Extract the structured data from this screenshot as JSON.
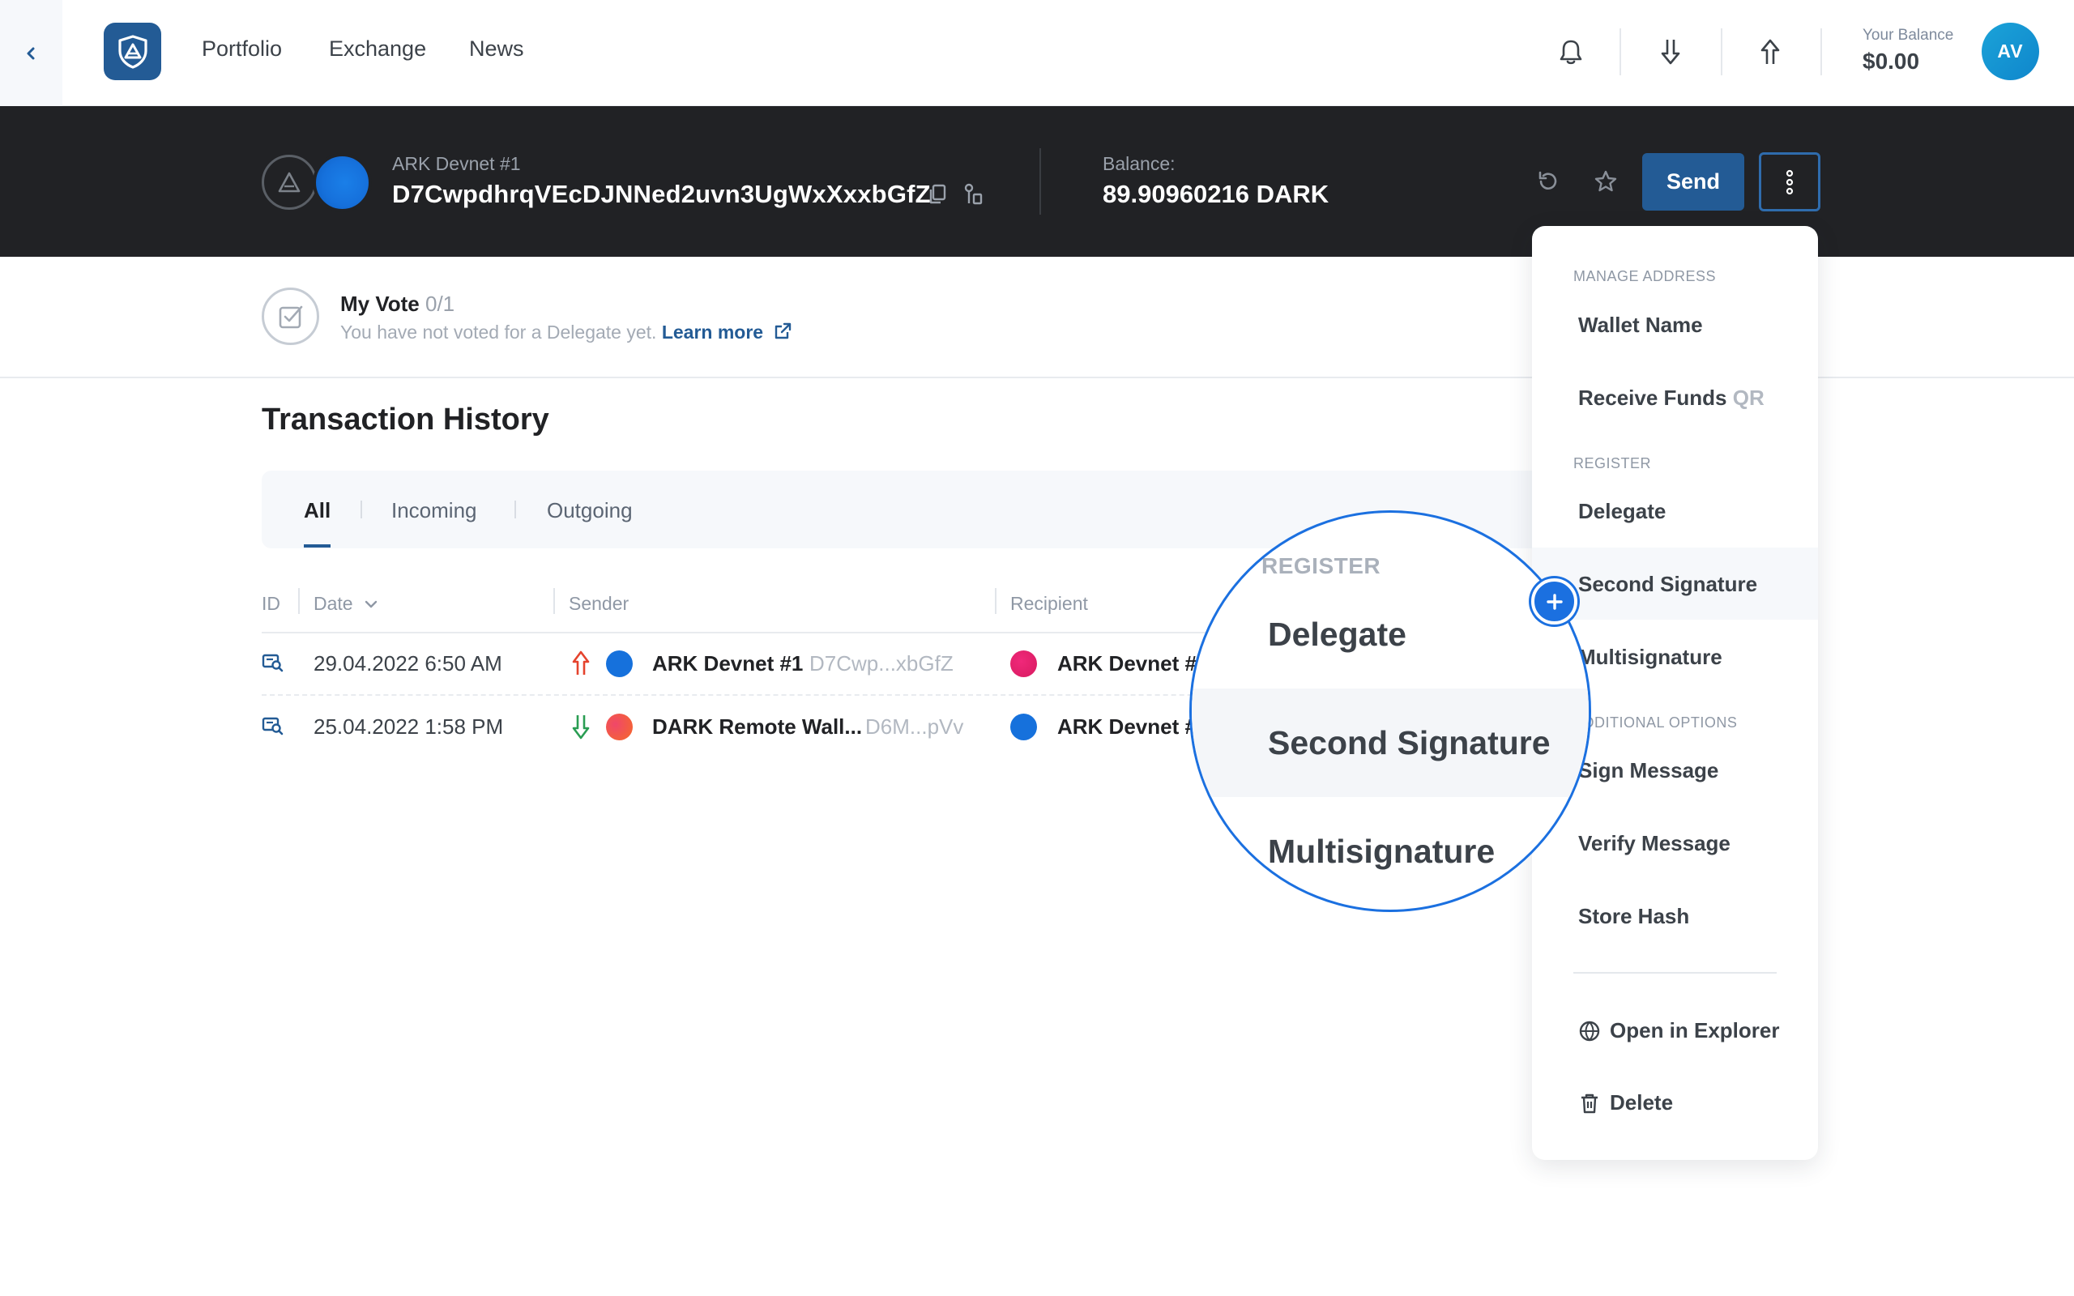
{
  "nav": {
    "links": [
      "Portfolio",
      "Exchange",
      "News"
    ],
    "balance_label": "Your Balance",
    "balance_value": "$0.00",
    "avatar_initials": "AV",
    "icons": [
      "bell-icon",
      "receive-arrow-icon",
      "send-arrow-icon"
    ]
  },
  "wallet": {
    "label": "ARK Devnet #1",
    "address": "D7CwpdhrqVEcDJNNed2uvn3UgWxXxxbGfZ",
    "balance_label": "Balance:",
    "balance_value": "89.90960216 DARK",
    "send_label": "Send"
  },
  "vote": {
    "title": "My Vote",
    "count": "0/1",
    "text": "You have not voted for a Delegate yet.",
    "link": "Learn more"
  },
  "history": {
    "title": "Transaction History",
    "tabs": [
      "All",
      "Incoming",
      "Outgoing"
    ],
    "active_tab": "All",
    "columns": [
      "ID",
      "Date",
      "Sender",
      "Recipient"
    ],
    "rows": [
      {
        "date": "29.04.2022 6:50 AM",
        "direction": "outgoing",
        "sender_name": "ARK Devnet #1",
        "sender_addr": "D7Cwp...xbGfZ",
        "recipient_name": "ARK Devnet #"
      },
      {
        "date": "25.04.2022 1:58 PM",
        "direction": "incoming",
        "sender_name": "DARK Remote Wall...",
        "sender_addr": "D6M...pVv",
        "recipient_name": "ARK Devnet #"
      }
    ]
  },
  "menu": {
    "sections": {
      "manage": "MANAGE ADDRESS",
      "register": "REGISTER",
      "additional": "ADDITIONAL OPTIONS"
    },
    "items": {
      "wallet_name": "Wallet Name",
      "receive_funds": "Receive Funds",
      "receive_funds_suffix": "QR",
      "delegate": "Delegate",
      "second_signature": "Second Signature",
      "multisignature": "Multisignature",
      "sign_message": "Sign Message",
      "verify_message": "Verify Message",
      "store_hash": "Store Hash",
      "open_explorer": "Open in Explorer",
      "delete": "Delete"
    },
    "highlighted": "Second Signature"
  },
  "magnifier": {
    "section": "REGISTER",
    "items": [
      "Delegate",
      "Second Signature",
      "Multisignature"
    ]
  },
  "colors": {
    "accent": "#235b95",
    "dark_header": "#212225",
    "highlight_ring": "#1b70e0",
    "outgoing": "#e5432d",
    "incoming": "#2a9d53"
  }
}
